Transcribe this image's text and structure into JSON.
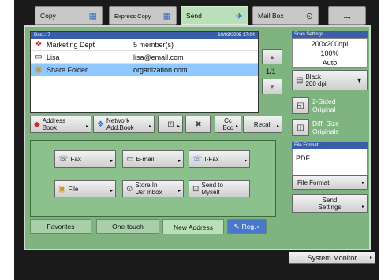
{
  "tabs": [
    {
      "label": "Copy",
      "icon": "copier-icon",
      "active": false
    },
    {
      "label": "Express Copy",
      "icon": "copier-icon",
      "active": false
    },
    {
      "label": "Send",
      "icon": "paper-plane-icon",
      "active": true
    },
    {
      "label": "Mail Box",
      "icon": "mailbox-icon",
      "active": false
    }
  ],
  "arrow_label": "→",
  "dest": {
    "header_left": "Dest.: 7",
    "header_right": "10/03/2005 17:04",
    "rows": [
      {
        "icon": "group-icon",
        "name": "Marketing Dept",
        "detail": "5 member(s)",
        "selected": false
      },
      {
        "icon": "email-icon",
        "name": "Lisa",
        "detail": "lisa@email.com",
        "selected": false
      },
      {
        "icon": "folder-icon",
        "name": "Share Folder",
        "detail": "organization.com",
        "selected": true
      }
    ],
    "page": "1/1"
  },
  "addr_buttons": [
    {
      "label": "Address\nBook"
    },
    {
      "label": "Network\nAdd.Book"
    },
    {
      "label": ""
    },
    {
      "label": ""
    },
    {
      "label": "Cc\nBcc"
    },
    {
      "label": "Recall"
    }
  ],
  "send_types": [
    {
      "label": "Fax"
    },
    {
      "label": "E-mail"
    },
    {
      "label": "I-Fax"
    },
    {
      "label": "File"
    },
    {
      "label": "Store In\nUsr Inbox"
    },
    {
      "label": "Send to\nMyself"
    }
  ],
  "bottom_tabs": [
    {
      "label": "Favorites"
    },
    {
      "label": "One-touch"
    },
    {
      "label": "New Address"
    },
    {
      "label": "Reg."
    }
  ],
  "scan": {
    "header": "Scan Settings",
    "resolution": "200x200dpi",
    "ratio": "100%",
    "mode": "Auto",
    "color_line1": "Black",
    "color_line2": "200 dpi"
  },
  "two_sided": "2-Sided\nOriginal",
  "diff_size": "Diff. Size\nOriginals",
  "file_format": {
    "header": "File Format",
    "value": "PDF",
    "button": "File Format"
  },
  "send_settings": "Send\nSettings",
  "system_monitor": "System Monitor"
}
